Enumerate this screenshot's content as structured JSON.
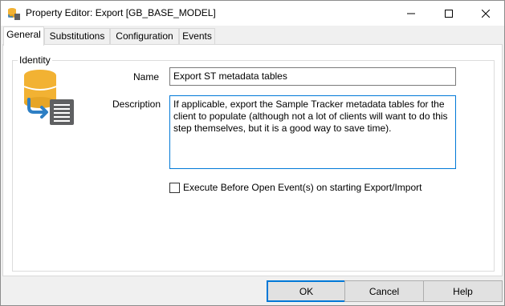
{
  "window": {
    "title": "Property Editor: Export [GB_BASE_MODEL]"
  },
  "tabs": [
    {
      "label": "General",
      "active": true
    },
    {
      "label": "Substitutions",
      "active": false
    },
    {
      "label": "Configuration",
      "active": false
    },
    {
      "label": "Events",
      "active": false
    }
  ],
  "identity": {
    "group_label": "Identity",
    "name_label": "Name",
    "name_value": "Export ST metadata tables",
    "description_label": "Description",
    "description_value": "If applicable, export the Sample Tracker metadata tables for the client to populate (although not a lot of clients will want to do this step themselves, but it is a good way to save time).",
    "execute_checkbox_label": "Execute Before Open Event(s) on starting Export/Import",
    "execute_checkbox_checked": false
  },
  "buttons": {
    "ok": "OK",
    "cancel": "Cancel",
    "help": "Help"
  },
  "colors": {
    "accent": "#0078d7",
    "icon_yellow": "#f2b233",
    "icon_blue": "#2e7fc4",
    "icon_gray": "#5f6062"
  },
  "icons": {
    "app": "database-export-icon",
    "identity": "database-export-icon"
  }
}
